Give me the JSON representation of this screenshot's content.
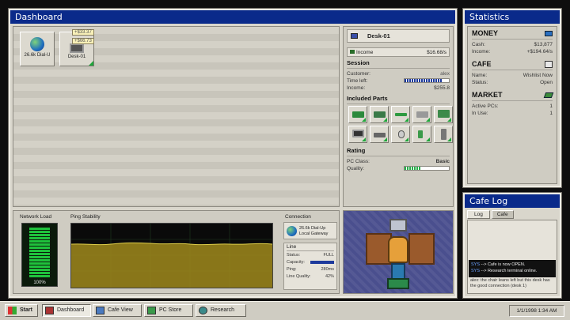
{
  "dashboard": {
    "title": "Dashboard",
    "icons": [
      {
        "label": "26.6k Dial-U",
        "icon": "globe-icon"
      },
      {
        "label": "Desk-01",
        "icon": "computer-desk-icon"
      }
    ],
    "float_labels": [
      "+$33.37",
      "+$66.73"
    ],
    "desk_panel": {
      "name": "Desk-01",
      "income_label": "Income",
      "income_value": "$16.68/s",
      "session": {
        "title": "Session",
        "customer_label": "Customer:",
        "customer_value": "alex",
        "time_label": "Time left:",
        "time_left_fraction": 0.85,
        "income_label": "Income:",
        "income_value": "$255.8"
      },
      "parts": {
        "title": "Included Parts",
        "items": [
          "gpu-icon",
          "motherboard-icon",
          "ram-icon",
          "drive-icon",
          "monitor-board-icon",
          "monitor-icon",
          "keyboard-icon",
          "mouse-icon",
          "speaker-icon",
          "case-icon"
        ]
      },
      "rating": {
        "title": "Rating",
        "class_label": "PC Class:",
        "class_value": "Basic",
        "quality_label": "Quality:",
        "quality_fraction": 0.35
      }
    },
    "network": {
      "load_title": "Network Load",
      "load_value": "100%",
      "load_fraction": 1.0,
      "stability_title": "Ping Stability",
      "connection_title": "Connection",
      "connection_name": "26.6k Dial-Up",
      "connection_sub": "Local Gateway",
      "line_title": "Line",
      "status_label": "Status:",
      "status_value": "FULL",
      "capacity_label": "Capacity:",
      "capacity_fraction": 1.0,
      "ping_label": "Ping:",
      "ping_value": "280ms",
      "quality_label": "Line Quality:",
      "quality_value": "42%"
    }
  },
  "statistics": {
    "title": "Statistics",
    "money_title": "MONEY",
    "cash_label": "Cash:",
    "cash_value": "$13,877",
    "income_label": "Income:",
    "income_value": "+$194.64/s",
    "cafe_title": "CAFE",
    "name_label": "Name:",
    "name_value": "Wishlist Now",
    "status_label": "Status:",
    "status_value": "Open",
    "market_title": "MARKET",
    "active_label": "Active PCs:",
    "active_value": "1",
    "inuse_label": "In Use:",
    "inuse_value": "1"
  },
  "cafe_log": {
    "title": "Cafe Log",
    "tabs": [
      "Log",
      "Cafe"
    ],
    "sys_prefix": "SYS",
    "entries": [
      "--> Cafe is now OPEN.",
      "--> Research terminal online."
    ],
    "chat": "alex: the chair leans left but this desk has the good connection (desk 1)"
  },
  "taskbar": {
    "start_label": "Start",
    "buttons": [
      "Dashboard",
      "Cafe View",
      "PC Store",
      "Research"
    ],
    "clock": "1/1/1998 1:34 AM"
  },
  "colors": {
    "titlebar": "#0a2a8a",
    "accent_green": "#1ea63a",
    "chart_fill": "#a08a1c"
  }
}
